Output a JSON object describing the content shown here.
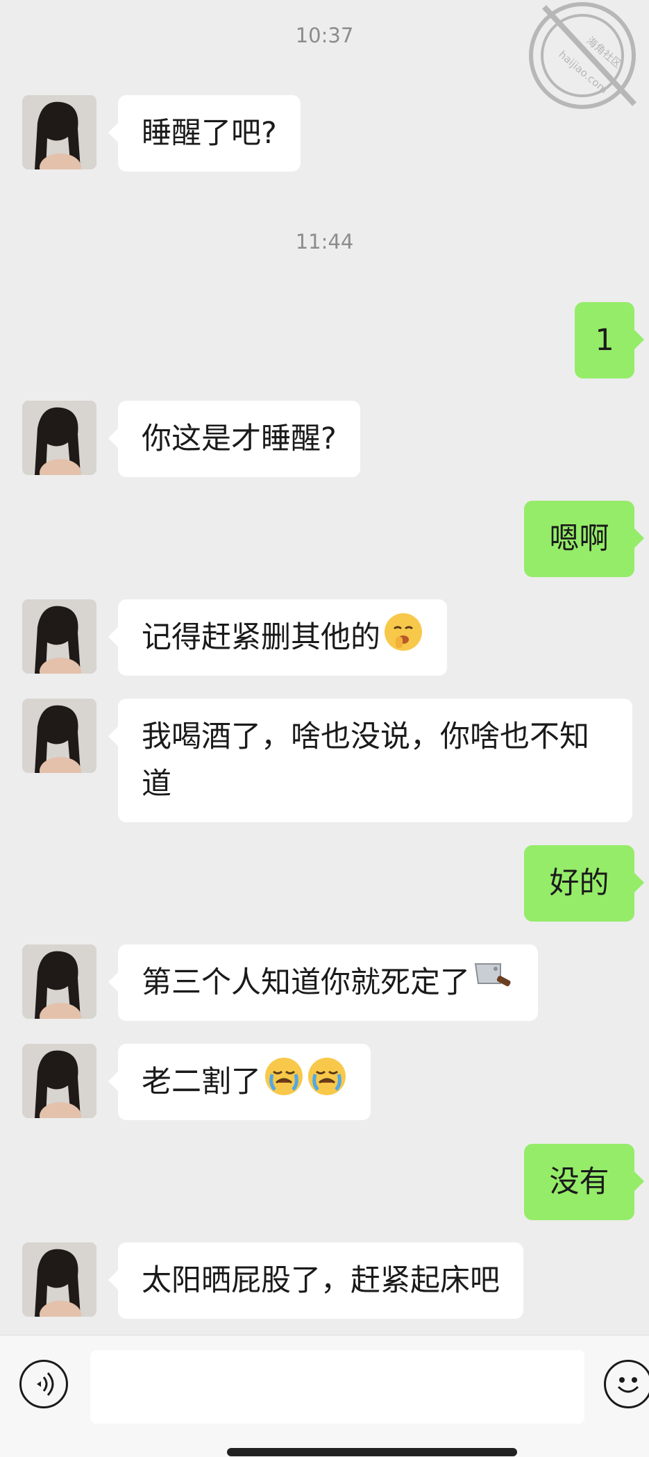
{
  "timestamps": [
    "10:37",
    "11:44"
  ],
  "watermark": {
    "text": "海角社区",
    "url_text": "haijiao.com"
  },
  "messages": [
    {
      "side": "in",
      "text": "睡醒了吧?"
    },
    {
      "side": "out",
      "text": "1"
    },
    {
      "side": "in",
      "text": "你这是才睡醒?"
    },
    {
      "side": "out",
      "text": "嗯啊"
    },
    {
      "side": "in",
      "text": "记得赶紧删其他的",
      "emoji": "shushing-face-emoji"
    },
    {
      "side": "in",
      "text_line1": "我喝酒了，啥也没说，你啥也不知",
      "text_line2": "道"
    },
    {
      "side": "out",
      "text": "好的"
    },
    {
      "side": "in",
      "text": "第三个人知道你就死定了",
      "emoji": "cleaver-knife-emoji"
    },
    {
      "side": "in",
      "text": "老二割了",
      "emoji": "crying-face-emoji"
    },
    {
      "side": "out",
      "text": "没有"
    },
    {
      "side": "in",
      "text": "太阳晒屁股了，赶紧起床吧"
    }
  ],
  "icons": {
    "voice": "voice-icon",
    "emoji": "smiley-icon"
  },
  "colors": {
    "background": "#ededed",
    "incoming": "#ffffff",
    "outgoing": "#95ec69",
    "timestamp": "#8c8c8c"
  }
}
